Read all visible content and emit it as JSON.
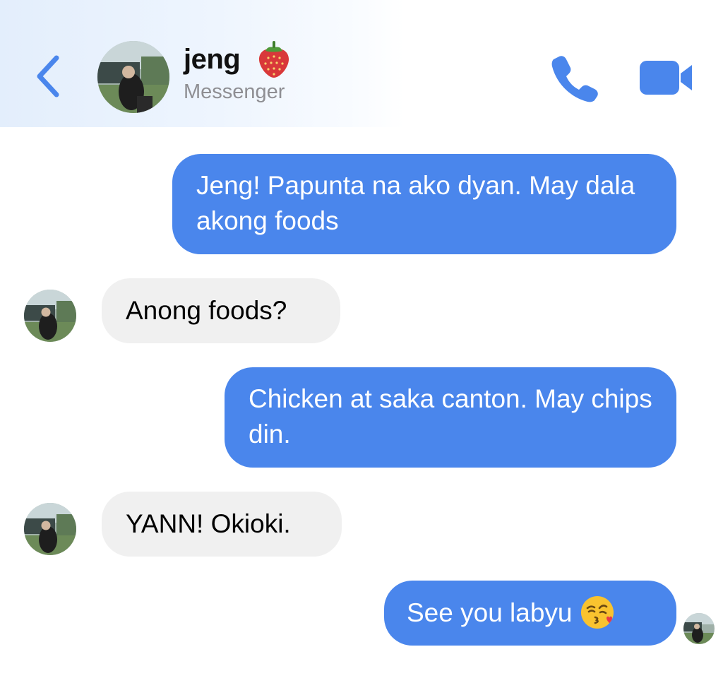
{
  "header": {
    "contact_name": "jeng",
    "subtitle": "Messenger",
    "name_emoji": "strawberry-emoji",
    "accent_color": "#4a86ec"
  },
  "icons": {
    "back": "chevron-left-icon",
    "call": "phone-icon",
    "video": "video-camera-icon"
  },
  "messages": [
    {
      "sender": "me",
      "text": "Jeng! Papunta na ako dyan. May dala akong foods"
    },
    {
      "sender": "jeng",
      "text": "Anong foods?"
    },
    {
      "sender": "me",
      "text": "Chicken at saka canton. May chips din."
    },
    {
      "sender": "jeng",
      "text": "YANN! Okioki."
    },
    {
      "sender": "me",
      "text": "See you labyu",
      "emoji": "kissing-heart-emoji"
    }
  ],
  "colors": {
    "outgoing_bubble": "#4a86ec",
    "incoming_bubble": "#f0f0f0",
    "subtitle_gray": "#8e8e93"
  }
}
